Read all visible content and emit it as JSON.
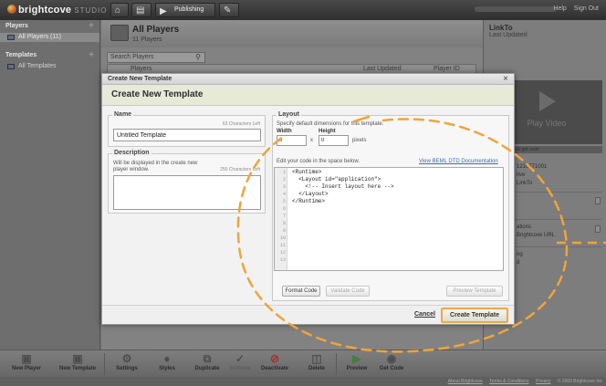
{
  "app": {
    "logo_text": "brightcove",
    "logo_suffix": "STUDIO",
    "nav": {
      "publishing_label": "Publishing"
    },
    "top_links": {
      "help": "Help",
      "sign_out": "Sign Out"
    }
  },
  "sidebar": {
    "players_header": "Players",
    "players_items": [
      {
        "label": "All Players (11)"
      }
    ],
    "templates_header": "Templates",
    "templates_items": [
      {
        "label": "All Templates"
      }
    ]
  },
  "main": {
    "title": "All Players",
    "subtitle": "11 Players",
    "search_placeholder": "Search Players",
    "columns": [
      "Players",
      "Last Updated",
      "Player ID"
    ]
  },
  "right_panel": {
    "title": "LinkTo",
    "subtitle": "Last Updated",
    "play_video": "Play Video",
    "id_fragment": "1210571001",
    "line1": "tive",
    "line2": "LinkTo",
    "line3": "ations",
    "line4": "Brightcove URL",
    "line5": "ng",
    "line6": "d",
    "share_row": "email  get link  get code"
  },
  "bottom_toolbar": {
    "items": [
      {
        "label": "New Player",
        "icon": "new-player-icon"
      },
      {
        "label": "New Template",
        "icon": "new-template-icon"
      },
      {
        "label": "Settings",
        "icon": "settings-icon"
      },
      {
        "label": "Styles",
        "icon": "styles-icon"
      },
      {
        "label": "Duplicate",
        "icon": "duplicate-icon"
      },
      {
        "label": "Activate",
        "icon": "activate-icon"
      },
      {
        "label": "Deactivate",
        "icon": "deactivate-icon"
      },
      {
        "label": "Delete",
        "icon": "delete-icon"
      },
      {
        "label": "Preview",
        "icon": "preview-icon"
      },
      {
        "label": "Get Code",
        "icon": "get-code-icon"
      }
    ]
  },
  "footer": {
    "about": "About Brightcove",
    "terms": "Terms & Conditions",
    "privacy": "Privacy",
    "copyright": "© 2009 Brightcove Inc"
  },
  "modal": {
    "window_title": "Create New Template",
    "header": "Create New Template",
    "name": {
      "label": "Name",
      "chars_left": "63 Characters Left",
      "value": "Untitled Template"
    },
    "description": {
      "label": "Description",
      "hint": "Will be displayed in the create new player window.",
      "chars_left": "250 Characters Left",
      "value": ""
    },
    "layout": {
      "label": "Layout",
      "hint": "Specify default dimensions for this template.",
      "width_label": "Width",
      "width_value": "0",
      "height_label": "Height",
      "height_value": "0",
      "x": "x",
      "units": "pixels",
      "edit_hint": "Edit your code in the space below.",
      "doc_link": "View BEML DTD Documentation",
      "line_numbers": [
        "1",
        "2",
        "3",
        "4",
        "5",
        "6",
        "7",
        "8",
        "9",
        "10",
        "11",
        "12",
        "13"
      ],
      "code_lines": [
        "<Runtime>",
        "  <Layout id=\"application\">",
        "    <!-- Insert layout here -->",
        "  </Layout>",
        "</Runtime>"
      ],
      "format_code": "Format Code",
      "validate_code": "Validate Code",
      "preview_template": "Preview Template"
    },
    "cancel": "Cancel",
    "create": "Create Template"
  },
  "colors": {
    "annotation_orange": "#f0a43a",
    "modal_header_bg": "#e6ead7",
    "link_blue": "#3a6fb0"
  }
}
